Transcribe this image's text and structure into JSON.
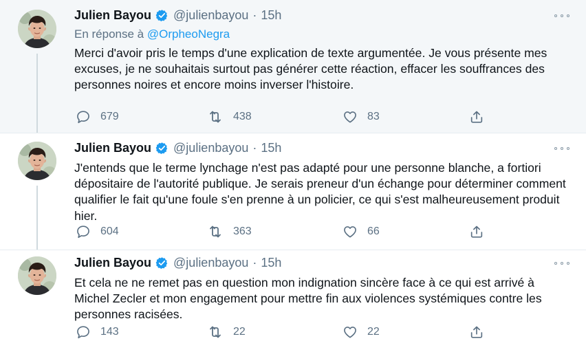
{
  "tweets": [
    {
      "author_name": "Julien Bayou",
      "handle": "@julienbayou",
      "separator": "·",
      "time": "15h",
      "reply_prefix": "En réponse à",
      "reply_mention": "@OrpheoNegra",
      "text": "Merci d'avoir pris le temps d'une explication de texte argumentée. Je vous présente mes excuses, je ne souhaitais surtout pas générer cette réaction, effacer les souffrances des personnes noires et encore moins inverser l'histoire.",
      "replies": "679",
      "retweets": "438",
      "likes": "83"
    },
    {
      "author_name": "Julien Bayou",
      "handle": "@julienbayou",
      "separator": "·",
      "time": "15h",
      "text": "J'entends que le terme lynchage n'est pas adapté pour une personne blanche, a fortiori dépositaire de l'autorité publique. Je serais preneur d'un échange pour déterminer comment qualifier le fait qu'une foule s'en prenne à un policier, ce qui s'est malheureusement produit hier.",
      "replies": "604",
      "retweets": "363",
      "likes": "66"
    },
    {
      "author_name": "Julien Bayou",
      "handle": "@julienbayou",
      "separator": "·",
      "time": "15h",
      "text": "Et cela ne ne remet pas en question mon indignation sincère face à ce qui est arrivé à Michel Zecler et mon engagement pour mettre fin aux violences systémiques contre les personnes racisées.",
      "replies": "143",
      "retweets": "22",
      "likes": "22"
    }
  ],
  "icons": {
    "verified": "verified-badge-icon",
    "more": "more-options-icon",
    "reply": "reply-bubble-icon",
    "retweet": "retweet-icon",
    "like": "heart-icon",
    "share": "share-upload-icon"
  },
  "colors": {
    "accent": "#1d9bf0",
    "secondary_text": "#5b7083",
    "highlight_background": "#f4f7f9"
  }
}
